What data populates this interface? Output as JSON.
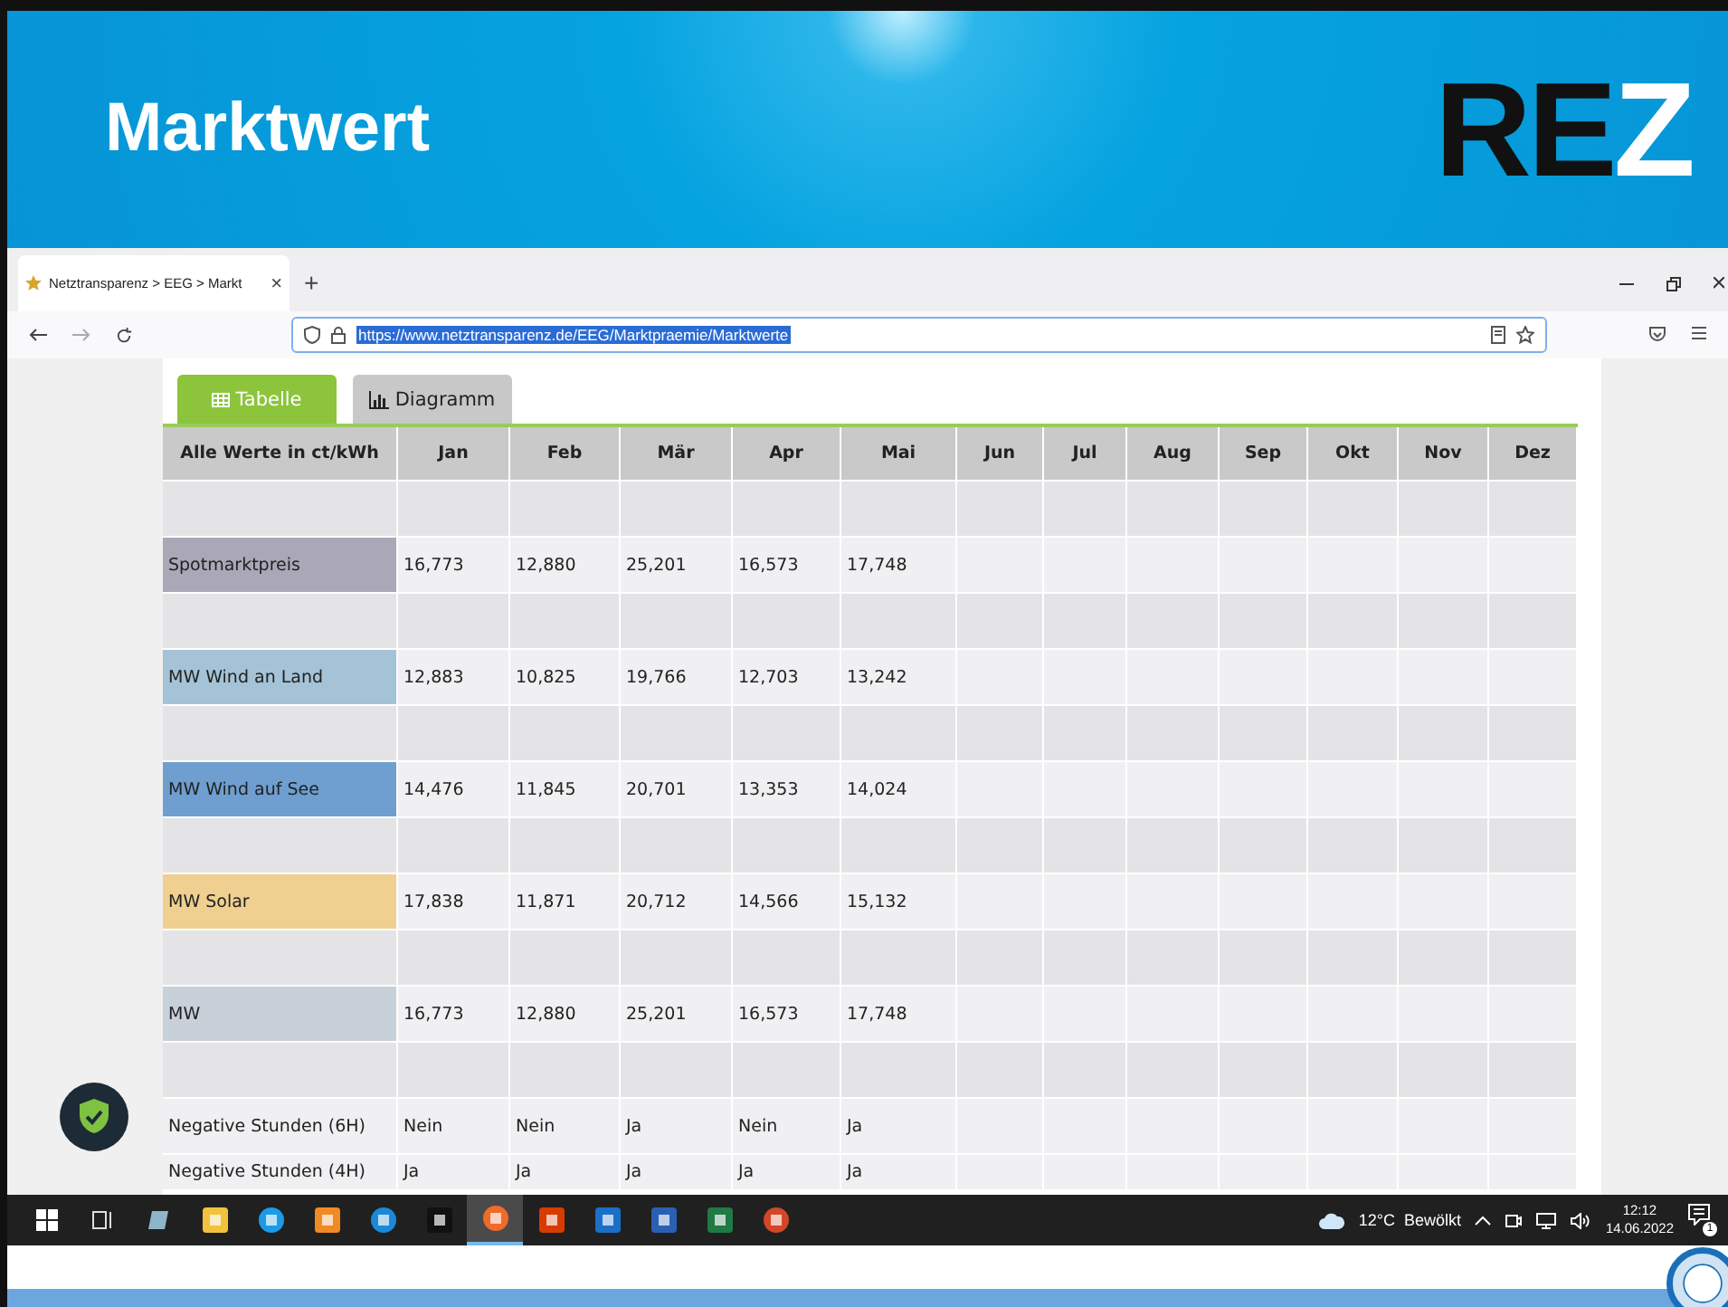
{
  "slide": {
    "title": "Marktwert",
    "logo": "REZ"
  },
  "browser": {
    "tab": {
      "title": "Netztransparenz > EEG > Markt",
      "close": "×"
    },
    "new_tab": "+",
    "url": "https://www.netztransparenz.de/EEG/Marktpraemie/Marktwerte"
  },
  "page_tabs": [
    {
      "label": "Tabelle",
      "kind": "table",
      "selected": true
    },
    {
      "label": "Diagramm",
      "kind": "chart",
      "selected": false
    }
  ],
  "table": {
    "columns": [
      "Alle Werte in ct/kWh",
      "Jan",
      "Feb",
      "Mär",
      "Apr",
      "Mai",
      "Jun",
      "Jul",
      "Aug",
      "Sep",
      "Okt",
      "Nov",
      "Dez"
    ],
    "rows": [
      {
        "kind": "spacer"
      },
      {
        "kind": "data",
        "label": "Spotmarktpreis",
        "color": "#aaa8b6",
        "values": [
          "16,773",
          "12,880",
          "25,201",
          "16,573",
          "17,748"
        ]
      },
      {
        "kind": "spacer"
      },
      {
        "kind": "data",
        "label": "MW Wind an Land",
        "color": "#a4c3d6",
        "values": [
          "12,883",
          "10,825",
          "19,766",
          "12,703",
          "13,242"
        ]
      },
      {
        "kind": "spacer"
      },
      {
        "kind": "data",
        "label": "MW Wind auf See",
        "color": "#6f9fd0",
        "values": [
          "14,476",
          "11,845",
          "20,701",
          "13,353",
          "14,024"
        ]
      },
      {
        "kind": "spacer"
      },
      {
        "kind": "data",
        "label": "MW Solar",
        "color": "#efd090",
        "values": [
          "17,838",
          "11,871",
          "20,712",
          "14,566",
          "15,132"
        ]
      },
      {
        "kind": "spacer"
      },
      {
        "kind": "data",
        "label": "MW",
        "color": "#c8d0da",
        "values": [
          "16,773",
          "12,880",
          "25,201",
          "16,573",
          "17,748"
        ]
      },
      {
        "kind": "spacer"
      },
      {
        "kind": "data",
        "label": "Negative Stunden (6H)",
        "values": [
          "Nein",
          "Nein",
          "Ja",
          "Nein",
          "Ja"
        ]
      },
      {
        "kind": "data",
        "label": "Negative Stunden (4H)",
        "values": [
          "Ja",
          "Ja",
          "Ja",
          "Ja",
          "Ja"
        ]
      }
    ]
  },
  "taskbar": {
    "apps": [
      {
        "kind": "explorer",
        "selected": false
      },
      {
        "kind": "skype",
        "selected": false
      },
      {
        "kind": "player",
        "selected": false
      },
      {
        "kind": "edge",
        "selected": false
      },
      {
        "kind": "archiver",
        "selected": false
      },
      {
        "kind": "firefox",
        "selected": true
      },
      {
        "kind": "office",
        "selected": false
      },
      {
        "kind": "outlook",
        "selected": false
      },
      {
        "kind": "word",
        "selected": false
      },
      {
        "kind": "excel",
        "selected": false
      },
      {
        "kind": "powerpoint",
        "selected": false
      }
    ],
    "weather": "12°C  Bewölkt",
    "time": "12:12",
    "date": "14.06.2022",
    "notifications": "1"
  }
}
